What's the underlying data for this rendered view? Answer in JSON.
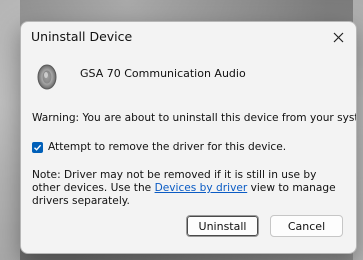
{
  "dialog": {
    "title": "Uninstall Device",
    "device_name": "GSA 70 Communication Audio",
    "device_icon": "speaker-icon",
    "warning": "Warning: You are about to uninstall this device from your system.",
    "checkbox": {
      "label": "Attempt to remove the driver for this device.",
      "checked": true
    },
    "note": {
      "before_link": "Note: Driver may not be removed if it is still in use by other devices. Use the ",
      "link_text": "Devices by driver",
      "after_link": " view to manage drivers separately."
    },
    "buttons": {
      "uninstall": "Uninstall",
      "cancel": "Cancel"
    }
  },
  "colors": {
    "accent": "#005fb8",
    "link": "#0a5bc4",
    "dialog_bg": "#f3f3f3"
  }
}
